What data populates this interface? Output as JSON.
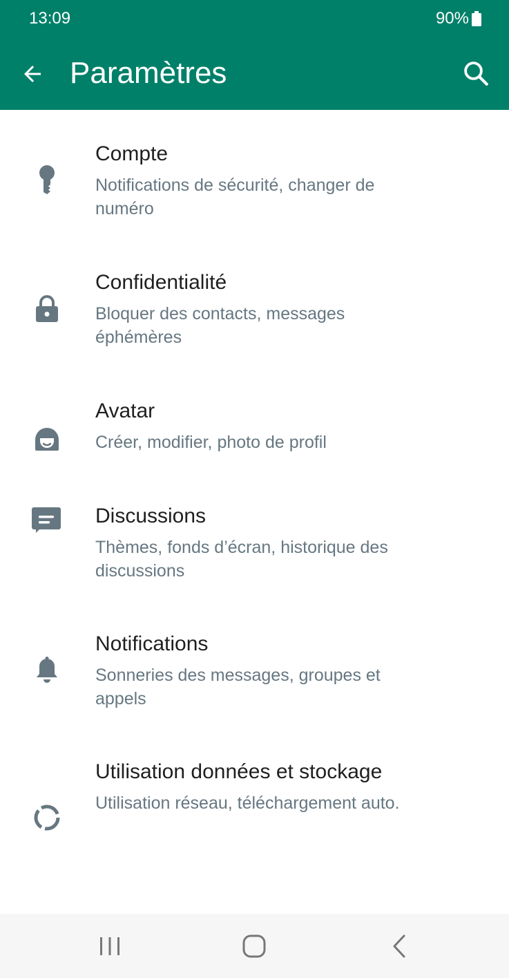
{
  "status_bar": {
    "time": "13:09",
    "battery": "90%"
  },
  "header": {
    "title": "Paramètres"
  },
  "icons": {
    "back": "arrow-left-icon",
    "search": "search-icon",
    "battery": "battery-icon"
  },
  "colors": {
    "header_bg": "#008069",
    "icon_gray": "#667781",
    "title_text": "#1f1f1f",
    "subtitle_text": "#667781",
    "nav_bg": "#f6f6f6"
  },
  "items": [
    {
      "title": "Compte",
      "subtitle": "Notifications de sécurité, changer de numéro",
      "icon": "key-icon"
    },
    {
      "title": "Confidentialité",
      "subtitle": "Bloquer des contacts, messages éphémères",
      "icon": "lock-icon"
    },
    {
      "title": "Avatar",
      "subtitle": "Créer, modifier, photo de profil",
      "icon": "avatar-icon"
    },
    {
      "title": "Discussions",
      "subtitle": "Thèmes, fonds d’écran, historique des discussions",
      "icon": "chat-icon"
    },
    {
      "title": "Notifications",
      "subtitle": "Sonneries des messages, groupes et appels",
      "icon": "bell-icon"
    },
    {
      "title": "Utilisation données et stockage",
      "subtitle": "Utilisation réseau, téléchargement auto.",
      "icon": "data-usage-icon"
    }
  ],
  "nav": {
    "recent": "recent-apps-icon",
    "home": "home-icon",
    "back": "back-icon"
  }
}
